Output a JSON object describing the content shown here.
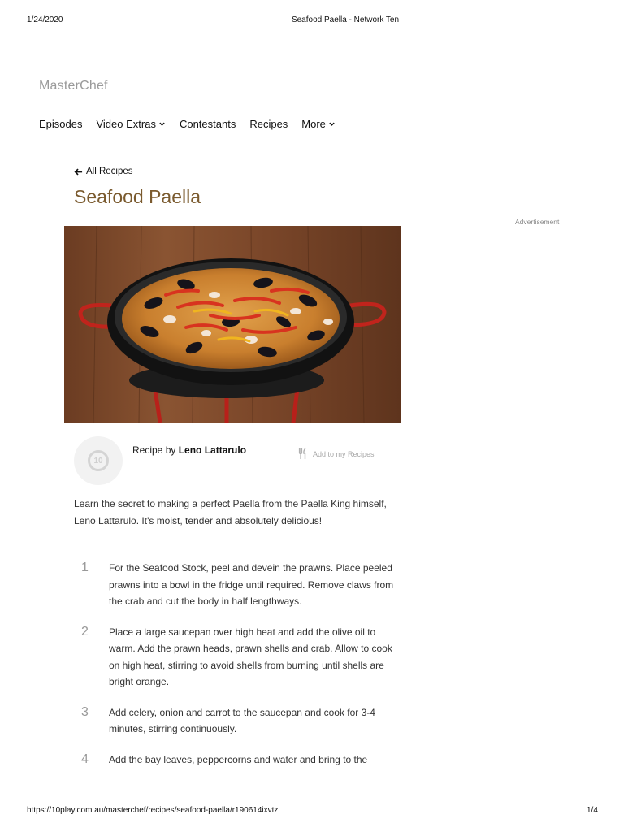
{
  "print": {
    "date": "1/24/2020",
    "title": "Seafood Paella - Network Ten",
    "url": "https://10play.com.au/masterchef/recipes/seafood-paella/r190614ixvtz",
    "page": "1/4"
  },
  "site": {
    "logo": "MasterChef"
  },
  "nav": [
    {
      "label": "Episodes",
      "dropdown": false
    },
    {
      "label": "Video Extras",
      "dropdown": true
    },
    {
      "label": "Contestants",
      "dropdown": false
    },
    {
      "label": "Recipes",
      "dropdown": false
    },
    {
      "label": "More",
      "dropdown": true
    }
  ],
  "back_link": {
    "label": "All Recipes",
    "icon": "arrow-left-icon"
  },
  "recipe": {
    "title": "Seafood Paella",
    "advertisement_label": "Advertisement",
    "author_prefix": "Recipe by",
    "author_name": "Leno Lattarulo",
    "add_to_my_recipes": "Add to my Recipes",
    "intro": "Learn the secret to making a perfect Paella from the Paella King himself, Leno Lattarulo. It's moist, tender and absolutely delicious!",
    "steps": [
      {
        "number": "1",
        "text": "For the Seafood Stock, peel and devein the prawns. Place peeled prawns into a bowl in the fridge until required. Remove claws from the crab and cut the body in half lengthways."
      },
      {
        "number": "2",
        "text": "Place a large saucepan over high heat and add the olive oil to warm. Add the prawn heads, prawn shells and crab. Allow to cook on high heat, stirring to avoid shells from burning until shells are bright orange."
      },
      {
        "number": "3",
        "text": "Add celery, onion and carrot to the saucepan and cook for 3-4 minutes, stirring continuously."
      },
      {
        "number": "4",
        "text": "Add the bay leaves, peppercorns and water and bring to the"
      }
    ]
  },
  "colors": {
    "title": "#7a5a2e",
    "logo": "#9a9a9a",
    "pan_handle": "#c0241c"
  }
}
